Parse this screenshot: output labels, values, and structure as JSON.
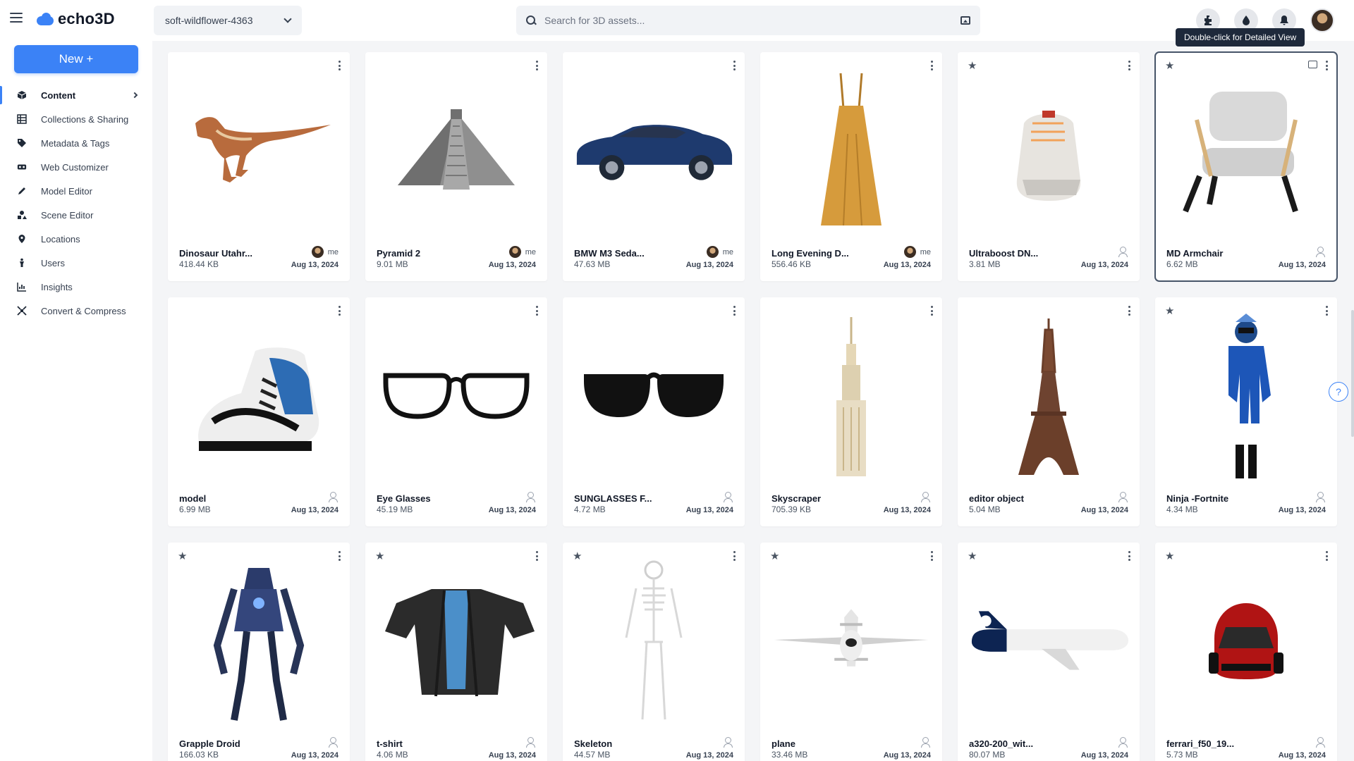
{
  "app": {
    "logo_text": "echo3D"
  },
  "header": {
    "project": "soft-wildflower-4363",
    "search_placeholder": "Search for 3D assets...",
    "icons": [
      "puzzle-icon",
      "drop-icon",
      "bell-icon"
    ],
    "tooltip": "Double-click for Detailed View"
  },
  "sidebar": {
    "new_button": "New +",
    "items": [
      {
        "label": "Content",
        "icon": "box-icon",
        "active": true
      },
      {
        "label": "Collections & Sharing",
        "icon": "grid-icon"
      },
      {
        "label": "Metadata & Tags",
        "icon": "tag-icon"
      },
      {
        "label": "Web Customizer",
        "icon": "vr-icon"
      },
      {
        "label": "Model Editor",
        "icon": "pencil-icon"
      },
      {
        "label": "Scene Editor",
        "icon": "shapes-icon"
      },
      {
        "label": "Locations",
        "icon": "pin-icon"
      },
      {
        "label": "Users",
        "icon": "person-icon"
      },
      {
        "label": "Insights",
        "icon": "chart-icon"
      },
      {
        "label": "Convert & Compress",
        "icon": "compress-icon"
      }
    ]
  },
  "cards": [
    {
      "name": "Dinosaur Utahr...",
      "size": "418.44 KB",
      "date": "Aug 13, 2024",
      "owner": "me",
      "starred": false,
      "thumb": "dinosaur"
    },
    {
      "name": "Pyramid 2",
      "size": "9.01 MB",
      "date": "Aug 13, 2024",
      "owner": "me",
      "starred": false,
      "thumb": "pyramid"
    },
    {
      "name": "BMW M3 Seda...",
      "size": "47.63 MB",
      "date": "Aug 13, 2024",
      "owner": "me",
      "starred": false,
      "thumb": "car"
    },
    {
      "name": "Long Evening D...",
      "size": "556.46 KB",
      "date": "Aug 13, 2024",
      "owner": "me",
      "starred": false,
      "thumb": "dress"
    },
    {
      "name": "Ultraboost DN...",
      "size": "3.81 MB",
      "date": "Aug 13, 2024",
      "owner": "",
      "starred": true,
      "thumb": "sneaker"
    },
    {
      "name": "MD Armchair",
      "size": "6.62 MB",
      "date": "Aug 13, 2024",
      "owner": "",
      "starred": true,
      "thumb": "armchair",
      "selected": true
    },
    {
      "name": "model",
      "size": "6.99 MB",
      "date": "Aug 13, 2024",
      "owner": "",
      "starred": false,
      "thumb": "jordan"
    },
    {
      "name": "Eye Glasses",
      "size": "45.19 MB",
      "date": "Aug 13, 2024",
      "owner": "",
      "starred": false,
      "thumb": "glasses"
    },
    {
      "name": "SUNGLASSES F...",
      "size": "4.72 MB",
      "date": "Aug 13, 2024",
      "owner": "",
      "starred": false,
      "thumb": "sunglasses"
    },
    {
      "name": "Skyscraper",
      "size": "705.39 KB",
      "date": "Aug 13, 2024",
      "owner": "",
      "starred": false,
      "thumb": "skyscraper"
    },
    {
      "name": "editor object",
      "size": "5.04 MB",
      "date": "Aug 13, 2024",
      "owner": "",
      "starred": false,
      "thumb": "eiffel"
    },
    {
      "name": "Ninja -Fortnite",
      "size": "4.34 MB",
      "date": "Aug 13, 2024",
      "owner": "",
      "starred": true,
      "thumb": "ninja"
    },
    {
      "name": "Grapple Droid",
      "size": "166.03 KB",
      "date": "Aug 13, 2024",
      "owner": "",
      "starred": true,
      "thumb": "droid"
    },
    {
      "name": "t-shirt",
      "size": "4.06 MB",
      "date": "Aug 13, 2024",
      "owner": "",
      "starred": true,
      "thumb": "jacket"
    },
    {
      "name": "Skeleton",
      "size": "44.57 MB",
      "date": "Aug 13, 2024",
      "owner": "",
      "starred": true,
      "thumb": "skeleton"
    },
    {
      "name": "plane",
      "size": "33.46 MB",
      "date": "Aug 13, 2024",
      "owner": "",
      "starred": true,
      "thumb": "jet"
    },
    {
      "name": "a320-200_wit...",
      "size": "80.07 MB",
      "date": "Aug 13, 2024",
      "owner": "",
      "starred": true,
      "thumb": "airliner"
    },
    {
      "name": "ferrari_f50_19...",
      "size": "5.73 MB",
      "date": "Aug 13, 2024",
      "owner": "",
      "starred": true,
      "thumb": "ferrari"
    }
  ],
  "help": "?"
}
